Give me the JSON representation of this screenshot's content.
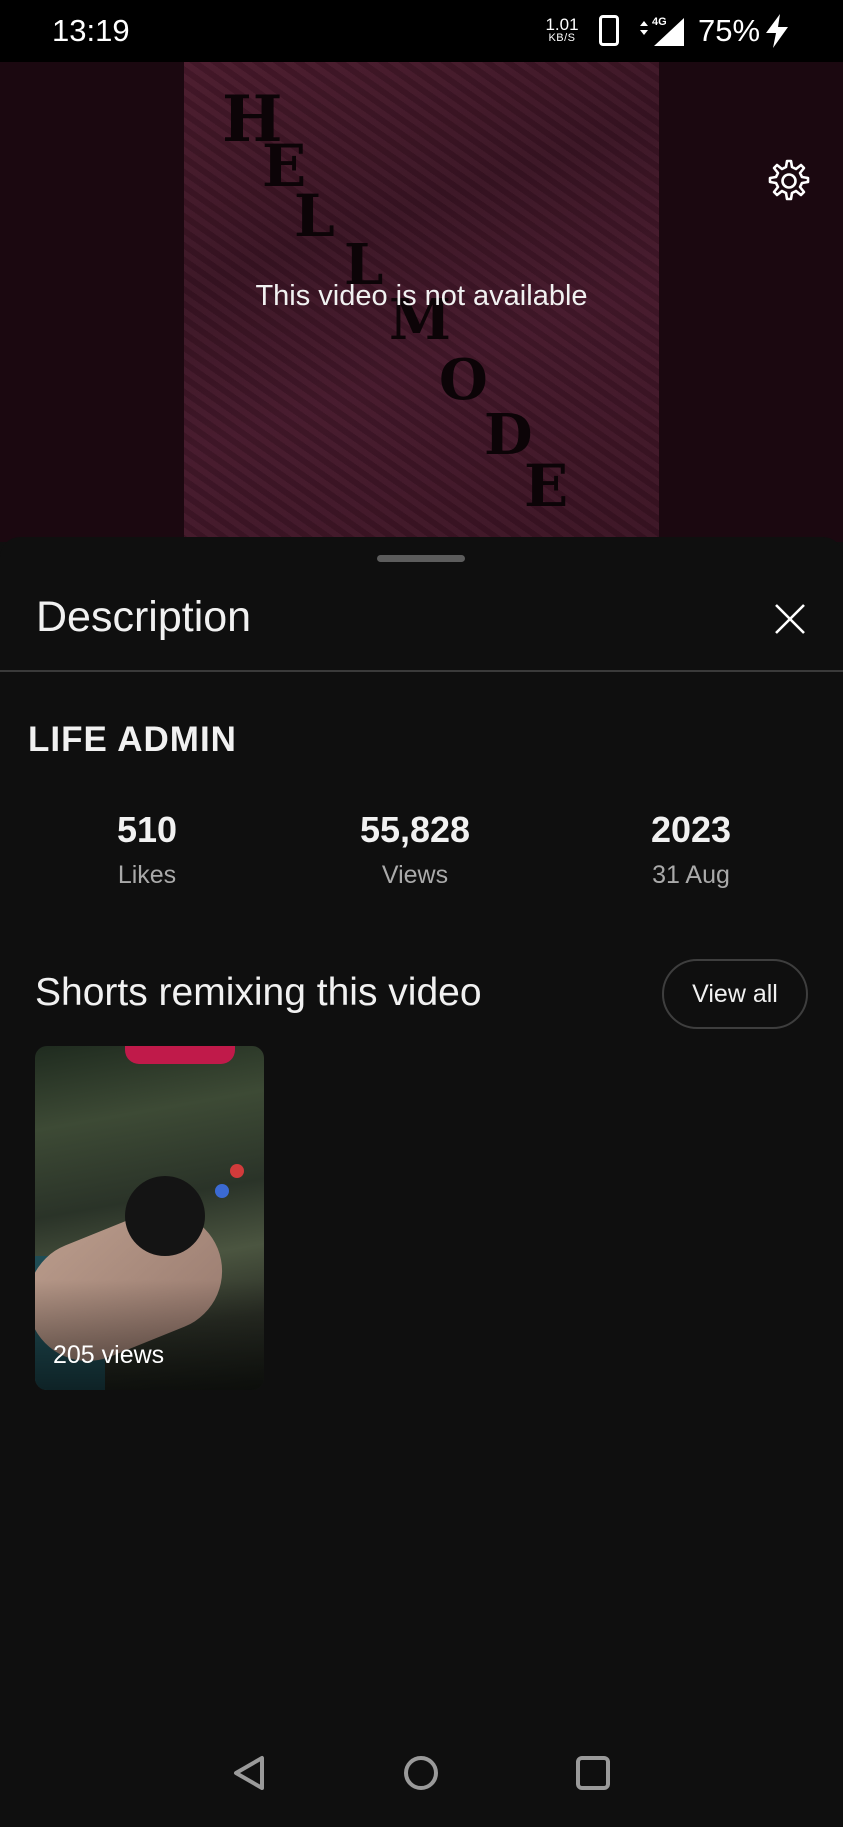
{
  "status_bar": {
    "time": "13:19",
    "net_speed_value": "1.01",
    "net_speed_unit": "KB/S",
    "network_type": "4G",
    "battery": "75%",
    "icons": [
      "phone-icon",
      "signal-icon",
      "charging-icon"
    ]
  },
  "video": {
    "message": "This video is not available",
    "icons": [
      "gear-icon"
    ]
  },
  "description_sheet": {
    "title": "Description",
    "icons": [
      "close-icon"
    ],
    "channel_name": "LIFE ADMIN",
    "stats": [
      {
        "value": "510",
        "label": "Likes"
      },
      {
        "value": "55,828",
        "label": "Views"
      },
      {
        "value": "2023",
        "label": "31 Aug"
      }
    ],
    "shorts_section": {
      "title": "Shorts remixing this video",
      "view_all_label": "View all",
      "items": [
        {
          "views": "205 views"
        }
      ]
    }
  },
  "nav_bar": {
    "icons": [
      "back-icon",
      "home-icon",
      "recents-icon"
    ]
  }
}
